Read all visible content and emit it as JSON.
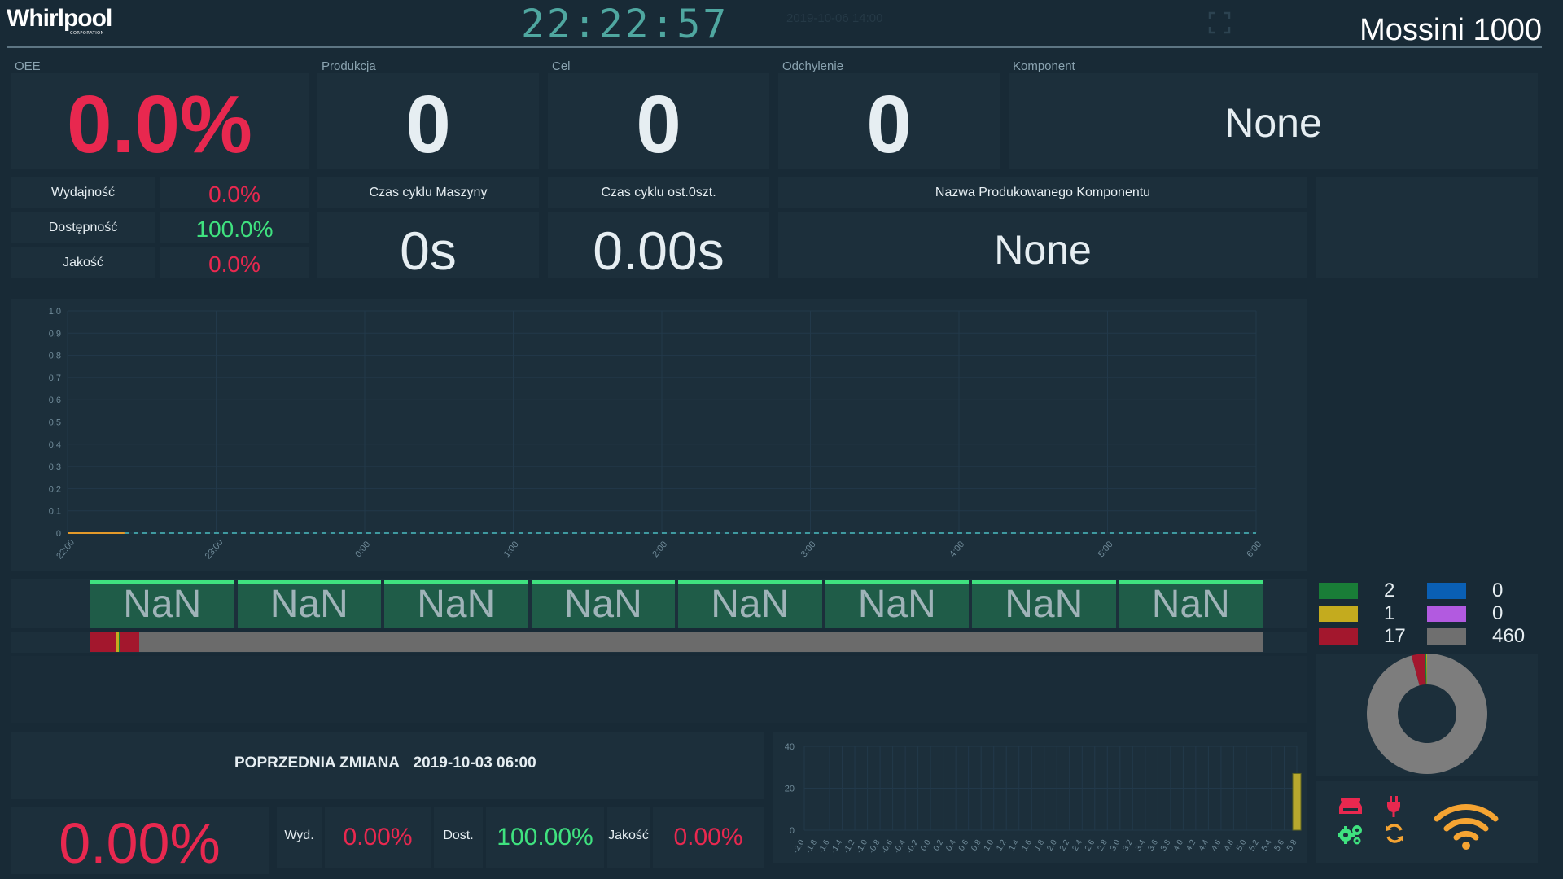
{
  "header": {
    "logo_text": "Whirlpool",
    "logo_sub": "CORPORATION",
    "clock": "22:22:57",
    "shift_time": "2019-10-06 14:00",
    "machine_name": "Mossini 1000"
  },
  "kpis": {
    "oee": {
      "label": "OEE",
      "value": "0.0%"
    },
    "produkcja": {
      "label": "Produkcja",
      "value": "0"
    },
    "cel": {
      "label": "Cel",
      "value": "0"
    },
    "odchylenie": {
      "label": "Odchylenie",
      "value": "0"
    },
    "komponent": {
      "label": "Komponent",
      "value": "None"
    }
  },
  "oee_breakdown": [
    {
      "label": "Wydajność",
      "value": "0.0%"
    },
    {
      "label": "Dostępność",
      "value": "100.0%"
    },
    {
      "label": "Jakość",
      "value": "0.0%"
    }
  ],
  "cycle": {
    "machine_label": "Czas cyklu Maszyny",
    "machine_value": "0s",
    "last_label": "Czas cyklu ost.0szt.",
    "last_value": "0.00s",
    "component_name_label": "Nazwa Produkowanego Komponentu",
    "component_name_value": "None"
  },
  "chart_data": [
    {
      "type": "line",
      "x": [
        "22:00",
        "23:00",
        "0:00",
        "1:00",
        "2:00",
        "3:00",
        "4:00",
        "5:00",
        "6:00"
      ],
      "ylim": [
        0,
        1.0
      ],
      "yticks": [
        "1.0",
        "0.9",
        "0.8",
        "0.7",
        "0.6",
        "0.5",
        "0.4",
        "0.3",
        "0.2",
        "0.1",
        "0"
      ],
      "series": [
        {
          "color": "#e39a2a",
          "style": "solid",
          "values_x": [
            "22:00",
            "22:23"
          ],
          "values_y": [
            0,
            0
          ]
        },
        {
          "color": "#3f9aa0",
          "style": "dashed",
          "values_x": [
            "22:23",
            "6:00"
          ],
          "values_y": [
            0,
            0
          ]
        }
      ],
      "grid": true
    },
    {
      "type": "bar",
      "ylim": [
        0,
        40
      ],
      "yticks": [
        "40",
        "20",
        "0"
      ],
      "x_ticks": [
        "-2.0",
        "-1.8",
        "-1.6",
        "-1.4",
        "-1.2",
        "-1.0",
        "-0.8",
        "-0.6",
        "-0.4",
        "-0.2",
        "0.0",
        "0.2",
        "0.4",
        "0.6",
        "0.8",
        "1.0",
        "1.2",
        "1.4",
        "1.6",
        "1.8",
        "2.0",
        "2.2",
        "2.4",
        "2.6",
        "2.8",
        "3.0",
        "3.2",
        "3.4",
        "3.6",
        "3.8",
        "4.0",
        "4.2",
        "4.4",
        "4.6",
        "4.8",
        "5.0",
        "5.2",
        "5.4",
        "5.6",
        "5.8"
      ],
      "bars": [
        {
          "x": "5.8",
          "value": 27,
          "color": "#b8a82e"
        }
      ],
      "grid": true
    },
    {
      "type": "pie",
      "donut": true,
      "slices": [
        {
          "value": 460,
          "color": "#7d7d7d"
        },
        {
          "value": 17,
          "color": "#a3172d"
        },
        {
          "value": 2,
          "color": "#197d37"
        },
        {
          "value": 1,
          "color": "#c4ab1e"
        }
      ]
    }
  ],
  "hour_blocks": [
    "NaN",
    "NaN",
    "NaN",
    "NaN",
    "NaN",
    "NaN",
    "NaN",
    "NaN"
  ],
  "status_legend": [
    {
      "color": "#197d37",
      "value": "2"
    },
    {
      "color": "#0a5fb4",
      "value": "0"
    },
    {
      "color": "#c4ab1e",
      "value": "1"
    },
    {
      "color": "#b25ae0",
      "value": "0"
    },
    {
      "color": "#a3172d",
      "value": "17"
    },
    {
      "color": "#6f6f6f",
      "value": "460"
    }
  ],
  "timeline": {
    "fractions": [
      {
        "color": "#a3172d",
        "share": 0.022
      },
      {
        "color": "#c4ab1e",
        "share": 0.002
      },
      {
        "color": "#197d37",
        "share": 0.002
      },
      {
        "color": "#a3172d",
        "share": 0.016
      },
      {
        "color": "#6b6b6b",
        "share": 0.958
      }
    ]
  },
  "previous_shift": {
    "title": "POPRZEDNIA ZMIANA",
    "date": "2019-10-03 06:00",
    "oee": "0.00%",
    "wyd_label": "Wyd.",
    "wyd_value": "0.00%",
    "dost_label": "Dost.",
    "dost_value": "100.00%",
    "jakosc_label": "Jakość",
    "jakosc_value": "0.00%"
  },
  "status_icons": [
    "printer-icon",
    "power-plug-icon",
    "gears-icon",
    "sync-icon",
    "wifi-icon"
  ],
  "colors": {
    "accent_pink": "#e8284f",
    "accent_green": "#3fe27f",
    "wifi": "#f5a432",
    "clock": "#4fa7a0"
  }
}
